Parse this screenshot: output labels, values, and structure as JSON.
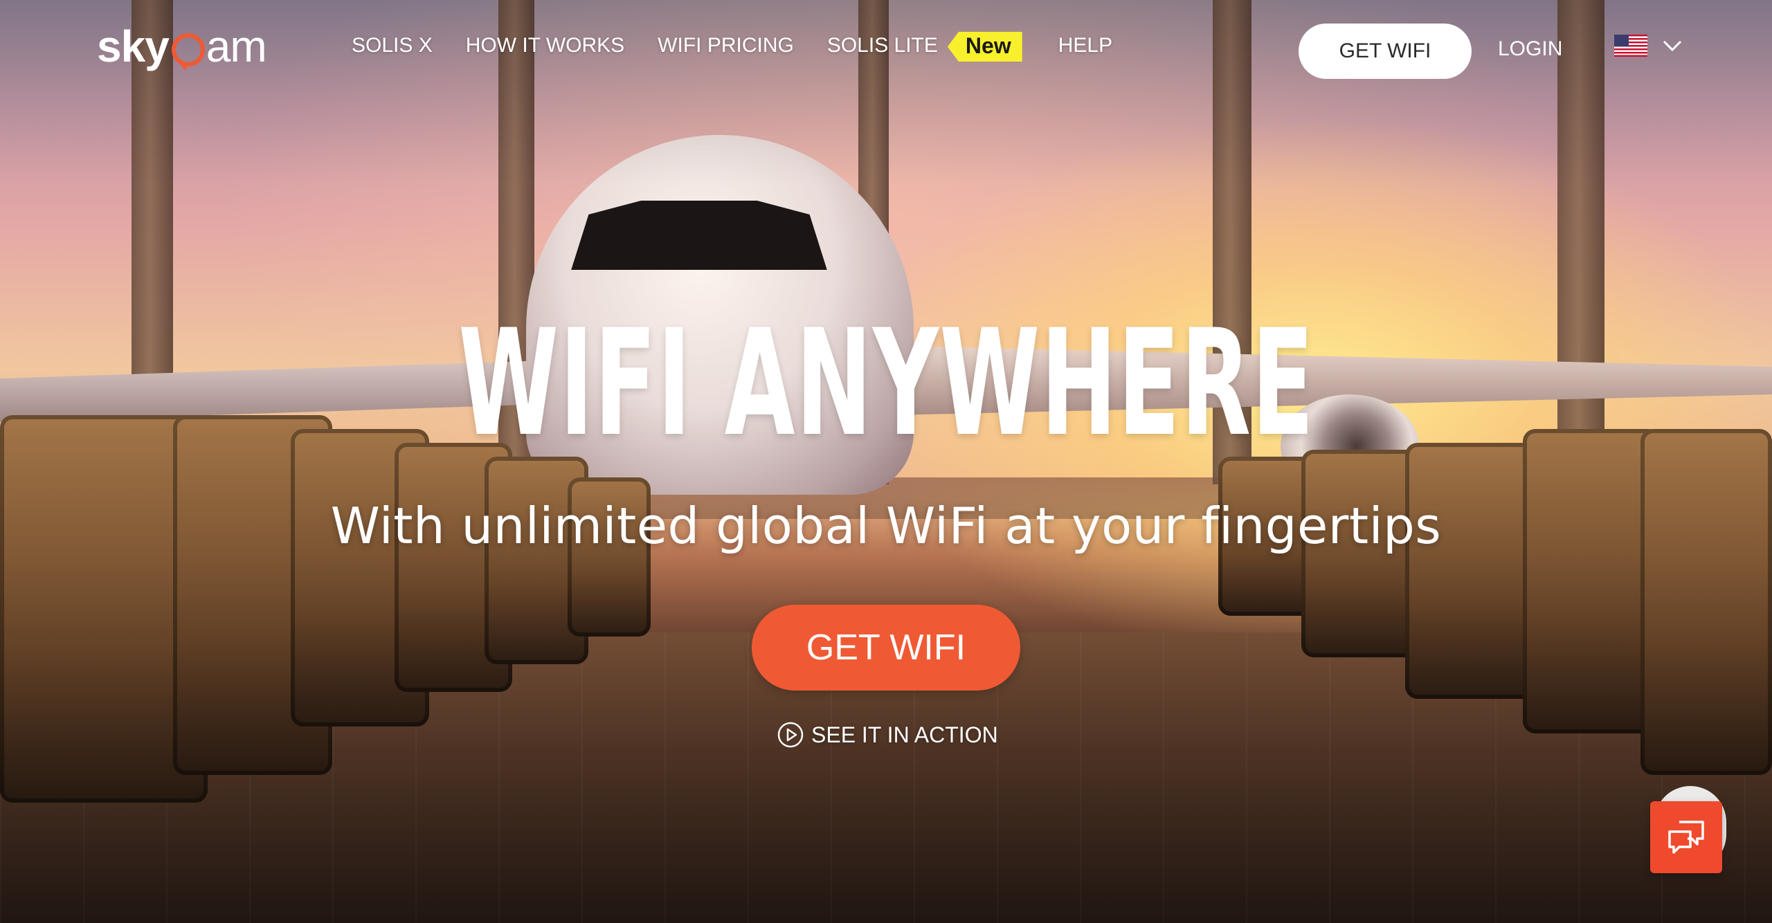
{
  "brand": {
    "logo_prefix": "sky",
    "logo_suffix": "am",
    "accent_color": "#ef5a34",
    "badge_color": "#f8f02c"
  },
  "nav": {
    "items": [
      {
        "label": "SOLIS X"
      },
      {
        "label": "HOW IT WORKS"
      },
      {
        "label": "WIFI PRICING"
      },
      {
        "label": "SOLIS LITE",
        "badge": "New"
      },
      {
        "label": "HELP"
      }
    ],
    "cta_label": "GET WIFI",
    "login_label": "LOGIN",
    "locale_icon": "us-flag-icon"
  },
  "hero": {
    "title": "WIFI ANYWHERE",
    "subtitle": "With unlimited global WiFi at your fingertips",
    "cta_label": "GET WIFI",
    "secondary_label": "SEE IT IN ACTION",
    "secondary_icon": "play-circle-icon"
  },
  "chat": {
    "icon": "chat-bubbles-icon"
  }
}
